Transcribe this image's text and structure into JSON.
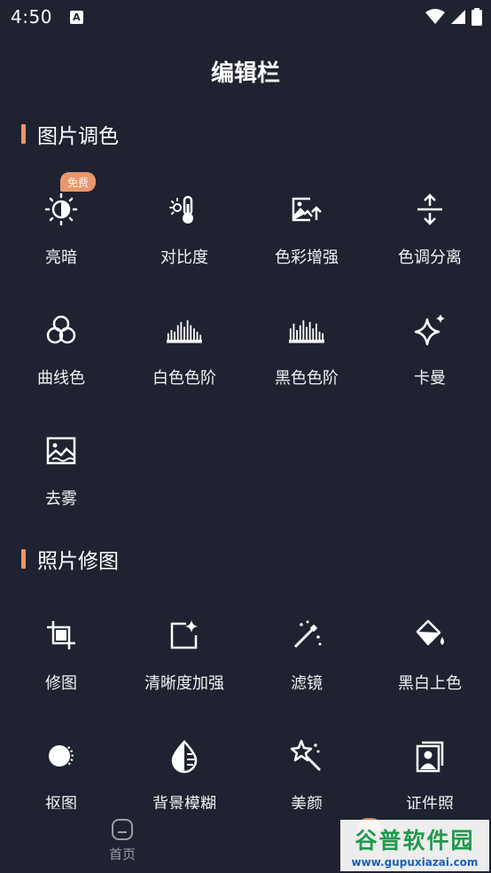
{
  "status_bar": {
    "time": "4:50",
    "notification_badge": "A"
  },
  "page": {
    "title": "编辑栏"
  },
  "sections": [
    {
      "title": "图片调色",
      "badge": "免费",
      "tools": [
        {
          "label": "亮暗",
          "icon": "brightness-icon"
        },
        {
          "label": "对比度",
          "icon": "thermometer-sun-icon"
        },
        {
          "label": "色彩增强",
          "icon": "image-enhance-icon"
        },
        {
          "label": "色调分离",
          "icon": "split-arrows-icon"
        },
        {
          "label": "曲线色",
          "icon": "color-circles-icon"
        },
        {
          "label": "白色色阶",
          "icon": "histogram-icon"
        },
        {
          "label": "黑色色阶",
          "icon": "histogram-icon"
        },
        {
          "label": "卡曼",
          "icon": "sparkle-icon"
        },
        {
          "label": "去雾",
          "icon": "dehaze-image-icon"
        }
      ]
    },
    {
      "title": "照片修图",
      "tools": [
        {
          "label": "修图",
          "icon": "crop-icon"
        },
        {
          "label": "清晰度加强",
          "icon": "sharpen-frame-icon"
        },
        {
          "label": "滤镜",
          "icon": "magic-wand-icon"
        },
        {
          "label": "黑白上色",
          "icon": "paint-bucket-icon"
        },
        {
          "label": "抠图",
          "icon": "cutout-circle-icon"
        },
        {
          "label": "背景模糊",
          "icon": "blur-drop-icon"
        },
        {
          "label": "美颜",
          "icon": "beauty-wand-icon"
        },
        {
          "label": "证件照",
          "icon": "id-photo-icon"
        }
      ]
    }
  ],
  "bottom_nav": {
    "home_label": "首页"
  },
  "watermark": {
    "title": "谷普软件园",
    "url": "www.gupuxiazai.com"
  },
  "colors": {
    "background": "#1f2230",
    "accent": "#f0936a",
    "text": "#ffffff"
  }
}
